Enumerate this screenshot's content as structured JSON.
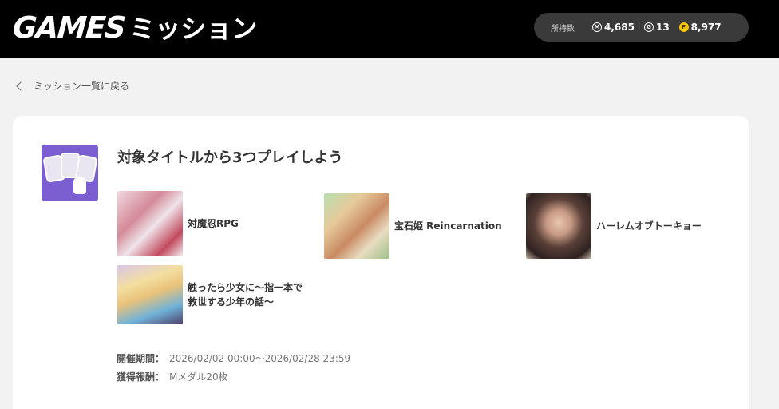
{
  "header": {
    "logo_games": "GAMES",
    "logo_mission": "ミッション",
    "balance_label": "所持数",
    "coins": [
      {
        "icon": "medal-icon",
        "symbol": "M",
        "value": "4,685"
      },
      {
        "icon": "gold-icon",
        "symbol": "G",
        "value": "13"
      },
      {
        "icon": "point-icon",
        "symbol": "P",
        "value": "8,977"
      }
    ]
  },
  "back_link": "ミッション一覧に戻る",
  "mission": {
    "title": "対象タイトルから3つプレイしよう",
    "games": [
      {
        "name": "対魔忍RPG"
      },
      {
        "name": "宝石姫 Reincarnation"
      },
      {
        "name": "ハーレムオブトーキョー"
      },
      {
        "name_line1": "触ったら少女に〜指一本で",
        "name_line2": "救世する少年の話〜"
      }
    ],
    "period_label": "開催期間：",
    "period_value": "2026/02/02 00:00〜2026/02/28 23:59",
    "reward_label": "獲得報酬：",
    "reward_value": "Mメダル20枚"
  },
  "colors": {
    "header_bg": "#000000",
    "balance_bg": "#3a3a3a",
    "point_coin": "#f5c400",
    "icon_bg": "#7b5fd0"
  }
}
